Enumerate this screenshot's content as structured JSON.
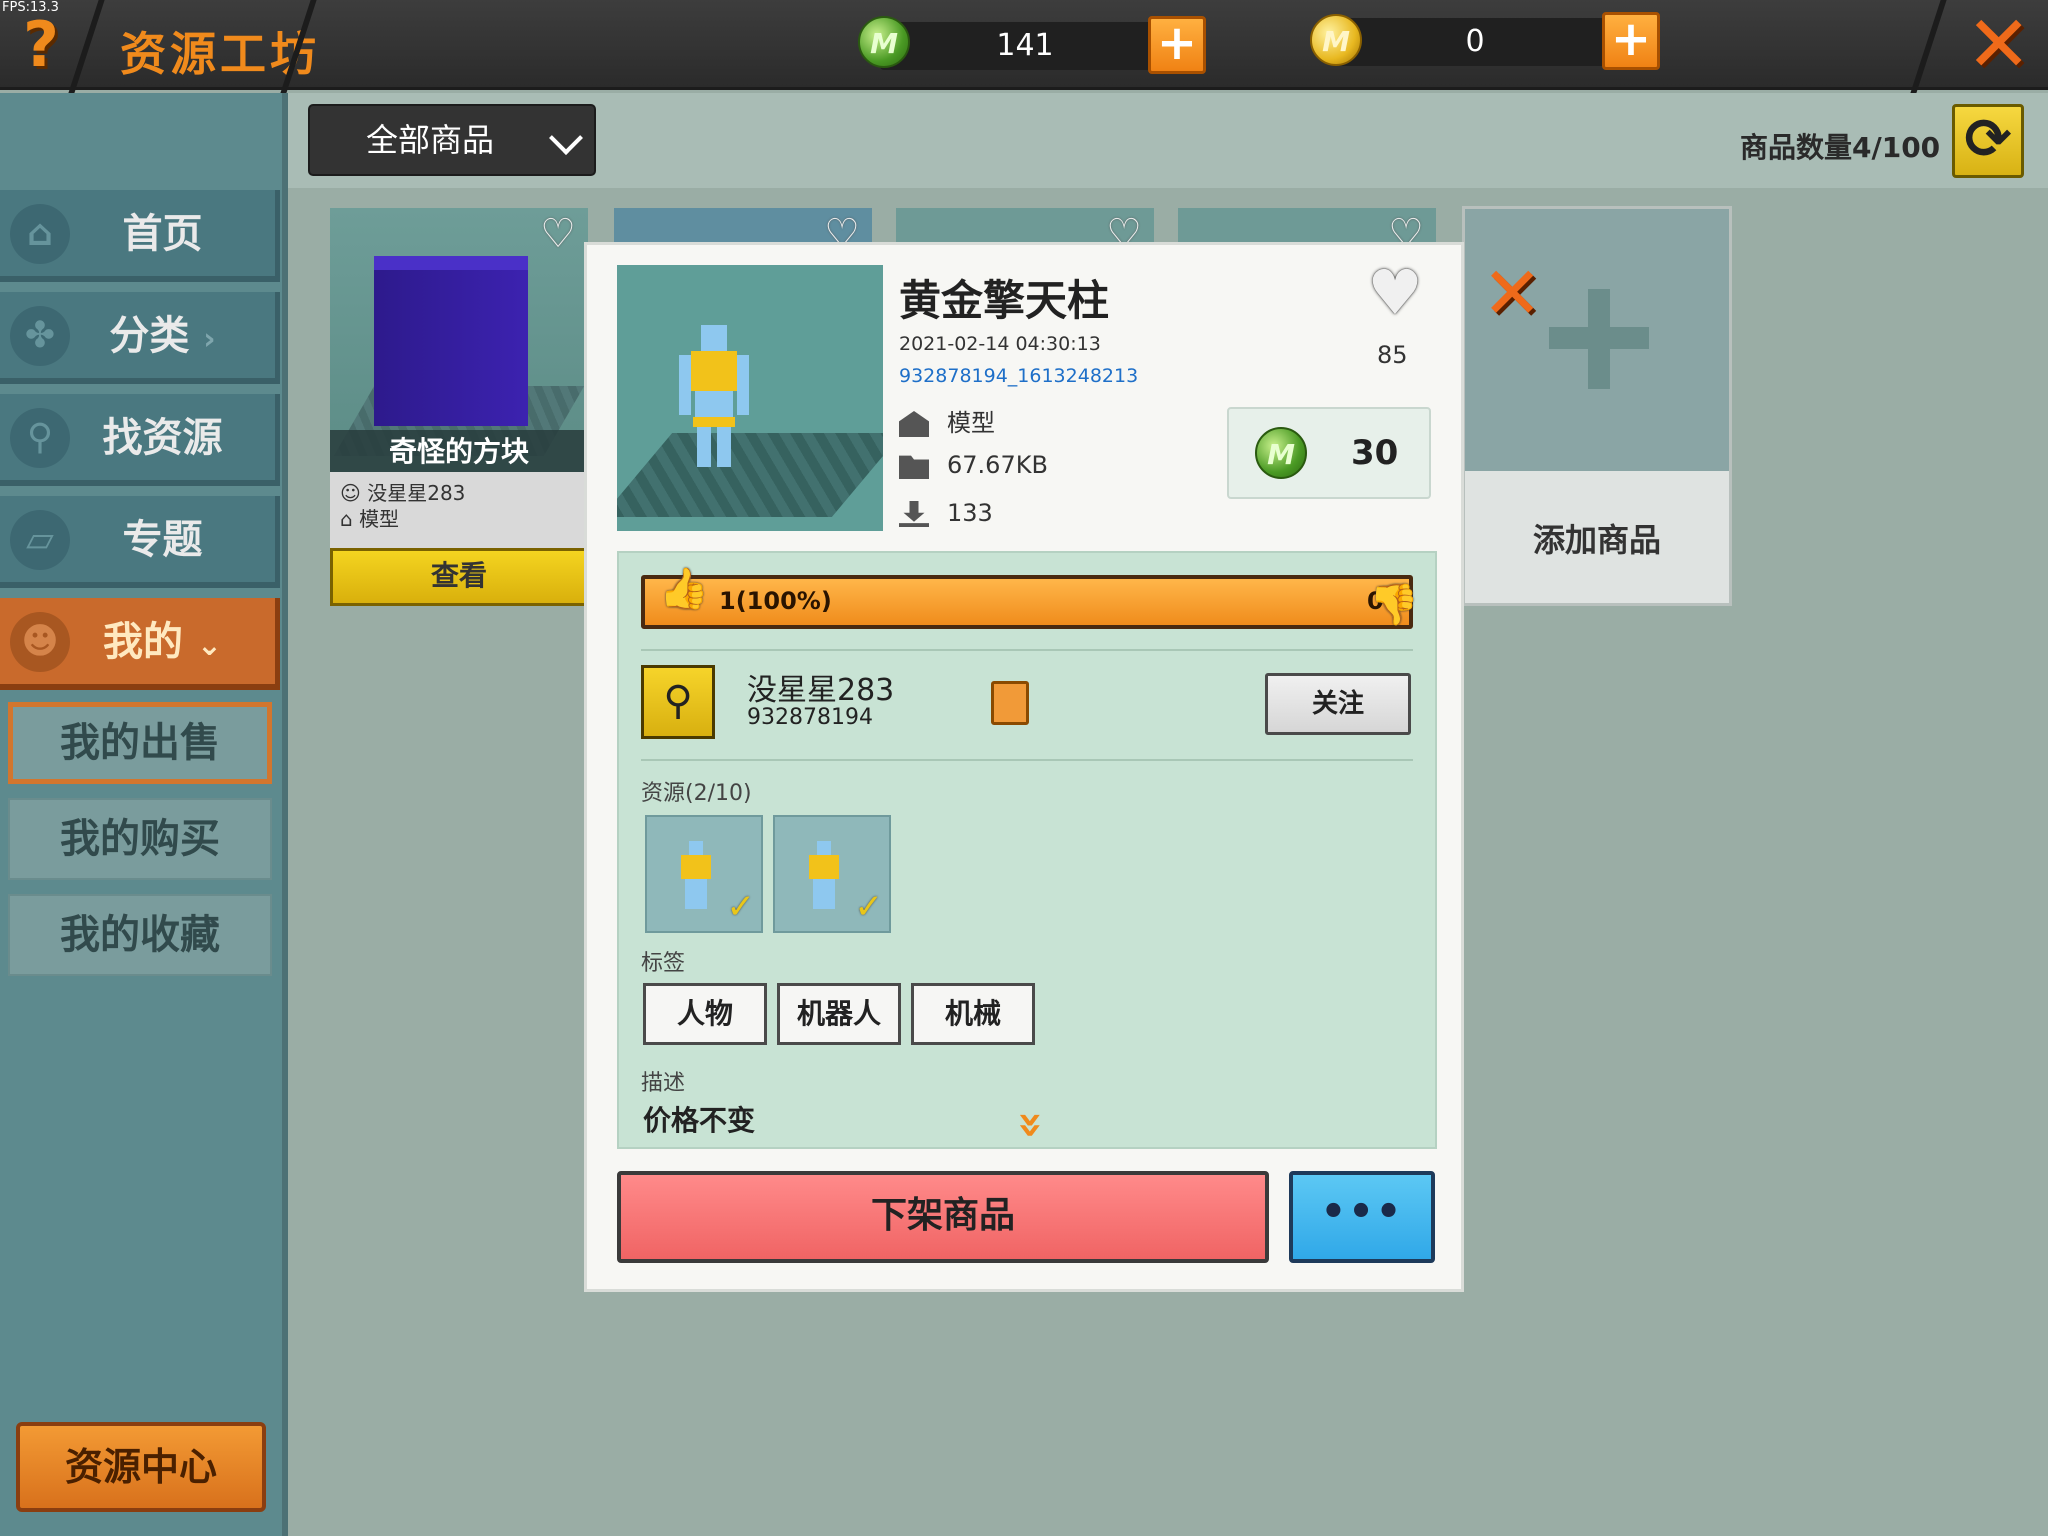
{
  "fps": "FPS:13.3",
  "header": {
    "help_icon": "?",
    "title": "资源工坊",
    "mini_coin": {
      "amount": "141",
      "icon": "M"
    },
    "gold_coin": {
      "amount": "0",
      "icon": "M"
    },
    "add_icon": "+",
    "close_icon": "✕"
  },
  "sidebar": {
    "items": [
      {
        "label": "首页",
        "icon": "home-icon"
      },
      {
        "label": "分类",
        "icon": "category-icon",
        "suffix": "›"
      },
      {
        "label": "找资源",
        "icon": "magnifier-icon"
      },
      {
        "label": "专题",
        "icon": "topic-icon"
      },
      {
        "label": "我的",
        "icon": "profile-icon",
        "suffix": "⌄",
        "active": true
      }
    ],
    "sub_items": [
      {
        "label": "我的出售",
        "active": true
      },
      {
        "label": "我的购买"
      },
      {
        "label": "我的收藏"
      }
    ],
    "resource_center": "资源中心"
  },
  "toolbar": {
    "filter_value": "全部商品",
    "item_count": "商品数量4/100",
    "refresh_icon": "⟳"
  },
  "grid": {
    "card1": {
      "name": "奇怪的方块",
      "author": "没星星283",
      "type": "模型",
      "view_button": "查看"
    },
    "add_card_label": "添加商品",
    "remove_icon": "✕"
  },
  "detail": {
    "title": "黄金擎天柱",
    "datetime": "2021-02-14  04:30:13",
    "resource_id": "932878194_1613248213",
    "type": "模型",
    "size": "67.67KB",
    "downloads": "133",
    "favorites": "85",
    "price": "30",
    "rating": {
      "up": "1(100%)",
      "down": "0",
      "up_fraction": 1.0
    },
    "author": {
      "name": "没星星283",
      "uid": "932878194",
      "follow": "关注"
    },
    "resources_label": "资源(2/10)",
    "tags_label": "标签",
    "tags": [
      "人物",
      "机器人",
      "机械"
    ],
    "description_label": "描述",
    "description": "价格不变",
    "expand_icon": "»",
    "unlist_button": "下架商品",
    "more_button": "•••"
  },
  "colors": {
    "accent_orange": "#f08a1c",
    "sidebar_bg": "#5d8a8e",
    "unlist_red": "#f06464",
    "more_blue": "#30a8e8"
  }
}
